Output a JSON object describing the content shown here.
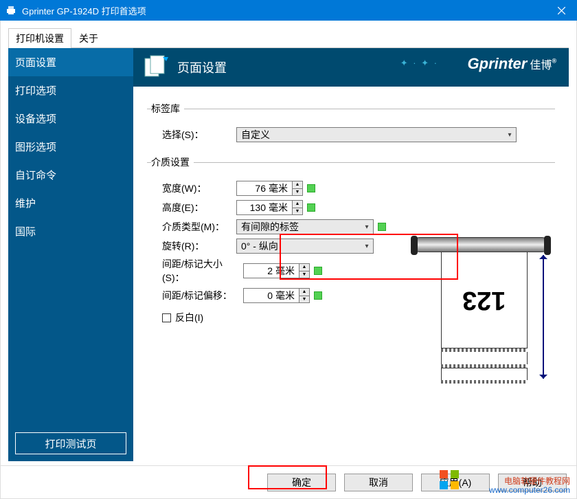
{
  "title": "Gprinter GP-1924D 打印首选项",
  "tabs": {
    "printer_settings": "打印机设置",
    "about": "关于"
  },
  "sidebar": {
    "items": [
      "页面设置",
      "打印选项",
      "设备选项",
      "图形选项",
      "自订命令",
      "维护",
      "国际"
    ],
    "print_test": "打印测试页"
  },
  "header": {
    "title": "页面设置",
    "brand_en": "Gprinter",
    "brand_cjk": "佳博",
    "reg": "®"
  },
  "section_stock": {
    "legend": "标签库",
    "select_label": "选择(S)：",
    "select_value": "自定义"
  },
  "section_media": {
    "legend": "介质设置",
    "width_label": "宽度(W)：",
    "width_value": "76",
    "height_label": "高度(E)：",
    "height_value": "130",
    "unit": "毫米",
    "type_label": "介质类型(M)：",
    "type_value": "有间隙的标签",
    "rotate_label": "旋转(R)：",
    "rotate_value": "0° - 纵向",
    "gap_size_label": "间距/标记大小(S)：",
    "gap_size_value": "2",
    "gap_offset_label": "间距/标记偏移：",
    "gap_offset_value": "0",
    "reverse_label": "反白(I)"
  },
  "preview_text": "123",
  "buttons": {
    "ok": "确定",
    "cancel": "取消",
    "apply": "应用(A)",
    "help": "帮助"
  },
  "watermark": {
    "line1": "电脑软硬件教程网",
    "line2": "www.computer26.com"
  }
}
